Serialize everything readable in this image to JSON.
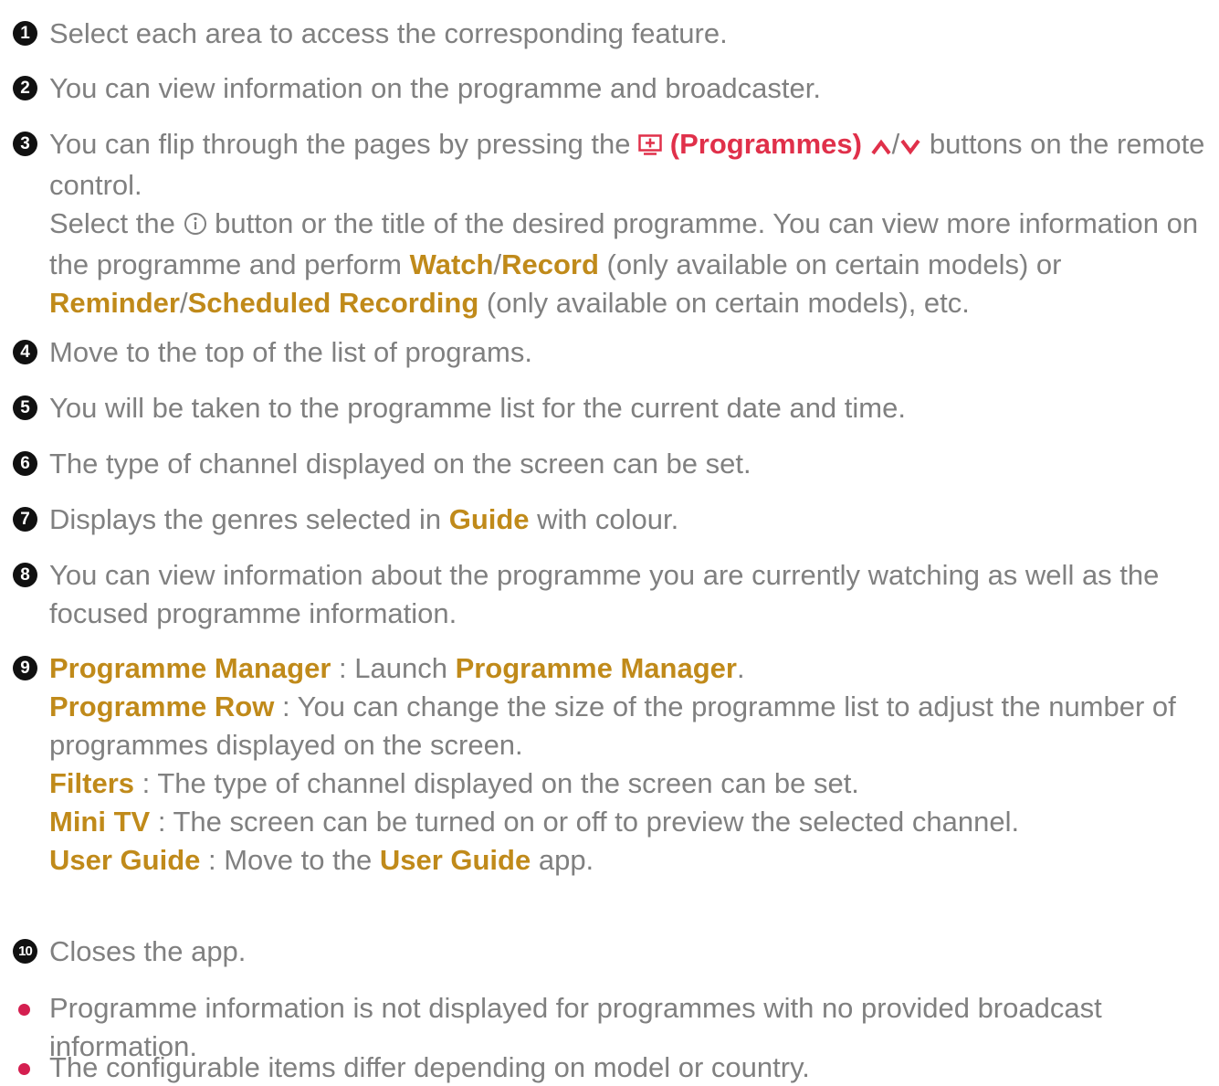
{
  "items": [
    {
      "num": "1",
      "text": "Select each area to access the corresponding feature."
    },
    {
      "num": "2",
      "text": "You can view information on the programme and broadcaster."
    },
    {
      "num": "3",
      "p1": "You can flip through the pages by pressing the",
      "programmes_label": "(Programmes)",
      "slash": "/",
      "p2": "buttons on the remote control.",
      "p3": "Select the",
      "p4": "button or the title of the desired programme. You can view more information on the programme and perform",
      "watch": "Watch",
      "record": "Record",
      "p5": "(only available on certain models) or",
      "reminder": "Reminder",
      "scheduled": "Scheduled Recording",
      "p6": "(only available on certain models), etc."
    },
    {
      "num": "4",
      "text": "Move to the top of the list of programs."
    },
    {
      "num": "5",
      "text": "You will be taken to the programme list for the current date and time."
    },
    {
      "num": "6",
      "text": "The type of channel displayed on the screen can be set."
    },
    {
      "num": "7",
      "p1": "Displays the genres selected in",
      "guide": "Guide",
      "p2": "with colour."
    },
    {
      "num": "8",
      "text": "You can view information about the programme you are currently watching as well as the focused programme information."
    },
    {
      "num": "9",
      "rows": [
        {
          "label": "Programme Manager",
          "sep": " : ",
          "text": "Launch ",
          "tail_hl": "Programme Manager",
          "tail": "."
        },
        {
          "label": "Programme Row",
          "sep": " : ",
          "text": "You can change the size of the programme list to adjust the number of programmes displayed on the screen."
        },
        {
          "label": "Filters",
          "sep": " : ",
          "text": "The type of channel displayed on the screen can be set."
        },
        {
          "label": "Mini TV",
          "sep": " : ",
          "text": "The screen can be turned on or off to preview the selected channel."
        },
        {
          "label": "User Guide",
          "sep": " : ",
          "text": "Move to the ",
          "tail_hl": "User Guide",
          "tail": " app."
        }
      ]
    },
    {
      "num": "10",
      "text": "Closes the app."
    }
  ],
  "notes": [
    "Programme information is not displayed for programmes with no provided broadcast information.",
    "The configurable items differ depending on model or country."
  ],
  "icons": {
    "programmes": "programmes-icon",
    "up": "chevron-up-icon",
    "down": "chevron-down-icon",
    "info": "info-icon"
  },
  "colors": {
    "text": "#808080",
    "highlight": "#c08a1a",
    "accent_red": "#e0304a",
    "bullet": "#d41f50",
    "number_badge": "#111111"
  }
}
